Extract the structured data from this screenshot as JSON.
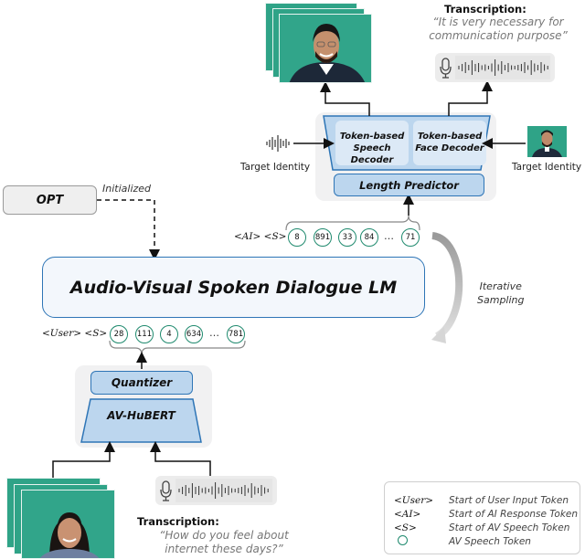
{
  "diagram": {
    "opt_label": "OPT",
    "initialized_label": "Initialized",
    "lm_label": "Audio-Visual Spoken Dialogue LM",
    "iterative_sampling_label": [
      "Iterative",
      "Sampling"
    ],
    "encoder": {
      "quantizer_label": "Quantizer",
      "avhubert_label": "AV-HuBERT"
    },
    "decoder": {
      "speech_decoder_label": [
        "Token-based",
        "Speech Decoder"
      ],
      "face_decoder_label": [
        "Token-based",
        "Face Decoder"
      ],
      "length_predictor_label": "Length Predictor",
      "target_identity_left": "Target Identity",
      "target_identity_right": "Target Identity"
    },
    "user_tokens": {
      "prefix": "<User> <S>",
      "values": [
        "28",
        "111",
        "4",
        "634",
        "781"
      ],
      "ellipsis": "…"
    },
    "ai_tokens": {
      "prefix": "<AI> <S>",
      "values": [
        "8",
        "891",
        "33",
        "84",
        "71"
      ],
      "ellipsis": "…"
    },
    "input": {
      "transcription_title": "Transcription:",
      "transcription_text": [
        "“How do you feel about",
        "internet these days?”"
      ]
    },
    "output": {
      "transcription_title": "Transcription:",
      "transcription_text": [
        "“It is very necessary for",
        "communication purpose”"
      ]
    },
    "icons": {
      "microphone": "microphone-icon",
      "waveform": "waveform-icon",
      "face_frames": "face-video-frames"
    },
    "colors": {
      "module_fill": "#bcd6ee",
      "module_stroke": "#2e75b6",
      "token_stroke": "#1f8a6e",
      "frame_bg": "#2fa387",
      "panel_bg": "#f1f1f2"
    }
  },
  "legend": {
    "items": [
      {
        "key": "<User>",
        "desc": "Start of User Input Token"
      },
      {
        "key": "<AI>",
        "desc": "Start of AI Response Token"
      },
      {
        "key": "<S>",
        "desc": "Start of AV Speech Token"
      },
      {
        "key": "○",
        "desc": "AV Speech Token"
      }
    ]
  }
}
